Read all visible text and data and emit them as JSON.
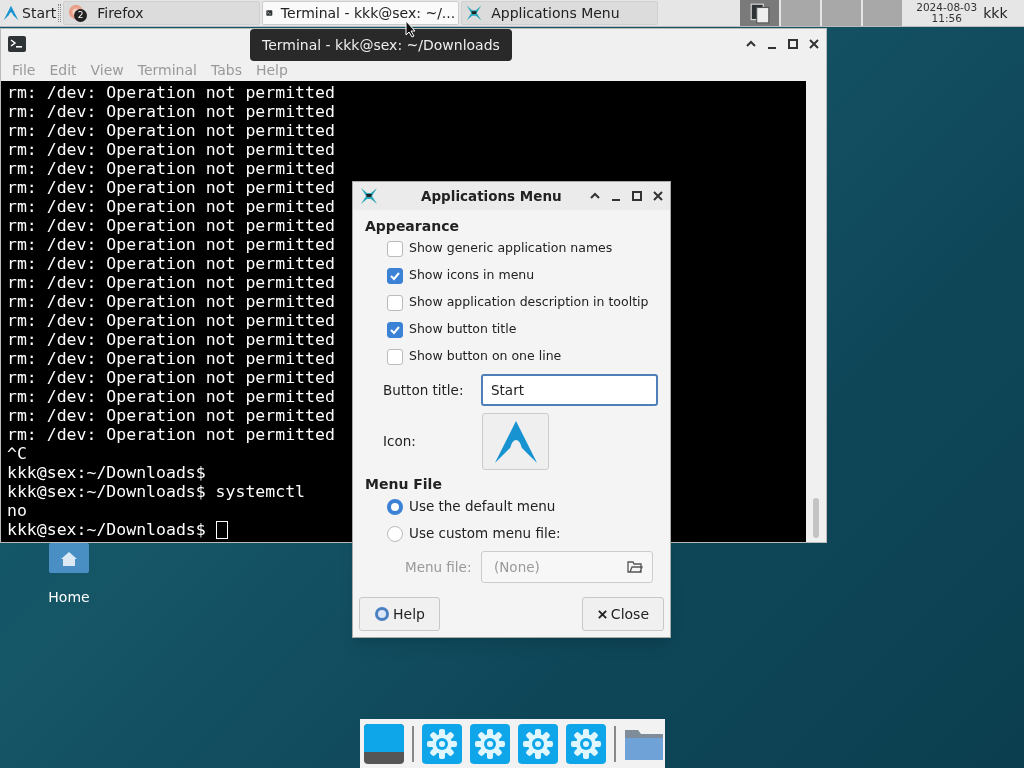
{
  "panel": {
    "start_button": "Start",
    "tasks": [
      {
        "kind": "firefox",
        "label": "Firefox",
        "badge": "2",
        "selected": false
      },
      {
        "kind": "terminal",
        "label": "Terminal - kkk@sex: ~/...",
        "selected": true
      },
      {
        "kind": "appmenu",
        "label": "Applications Menu",
        "selected": false
      }
    ],
    "workspaces": [
      {
        "selected": true
      },
      {
        "selected": false
      },
      {
        "selected": false
      },
      {
        "selected": false
      }
    ],
    "clock": {
      "date": "2024-08-03",
      "time": "11:56"
    },
    "user": "kkk"
  },
  "tooltip": "Terminal - kkk@sex: ~/Downloads",
  "terminal": {
    "menu": [
      "File",
      "Edit",
      "View",
      "Terminal",
      "Tabs",
      "Help"
    ],
    "lines": [
      "rm: /dev: Operation not permitted",
      "rm: /dev: Operation not permitted",
      "rm: /dev: Operation not permitted",
      "rm: /dev: Operation not permitted",
      "rm: /dev: Operation not permitted",
      "rm: /dev: Operation not permitted",
      "rm: /dev: Operation not permitted",
      "rm: /dev: Operation not permitted",
      "rm: /dev: Operation not permitted",
      "rm: /dev: Operation not permitted",
      "rm: /dev: Operation not permitted",
      "rm: /dev: Operation not permitted",
      "rm: /dev: Operation not permitted",
      "rm: /dev: Operation not permitted",
      "rm: /dev: Operation not permitted",
      "rm: /dev: Operation not permitted",
      "rm: /dev: Operation not permitted",
      "rm: /dev: Operation not permitted",
      "rm: /dev: Operation not permitted",
      "^C",
      "kkk@sex:~/Downloads$",
      "kkk@sex:~/Downloads$ systemctl",
      "no",
      "kkk@sex:~/Downloads$"
    ]
  },
  "desktop_icons": [
    {
      "label": "Home"
    }
  ],
  "dialog": {
    "title": "Applications Menu",
    "appearance": {
      "heading": "Appearance",
      "options": [
        {
          "label": "Show generic application names",
          "checked": false
        },
        {
          "label": "Show icons in menu",
          "checked": true
        },
        {
          "label": "Show application description in tooltip",
          "checked": false
        },
        {
          "label": "Show button title",
          "checked": true
        },
        {
          "label": "Show button on one line",
          "checked": false
        }
      ],
      "button_title": {
        "label": "Button title:",
        "value": "Start"
      },
      "icon": {
        "label": "Icon:"
      }
    },
    "menu_file": {
      "heading": "Menu File",
      "options": [
        {
          "label": "Use the default menu",
          "selected": true
        },
        {
          "label": "Use custom menu file:",
          "selected": false
        }
      ],
      "file": {
        "label": "Menu file:",
        "placeholder": "(None)",
        "disabled": true
      }
    },
    "buttons": [
      {
        "kind": "help",
        "label": "Help"
      },
      {
        "kind": "close",
        "label": "Close"
      }
    ]
  },
  "dock": [
    {
      "kind": "desktop"
    },
    {
      "kind": "gear"
    },
    {
      "kind": "gear"
    },
    {
      "kind": "gear"
    },
    {
      "kind": "gear"
    },
    {
      "kind": "folder"
    }
  ]
}
